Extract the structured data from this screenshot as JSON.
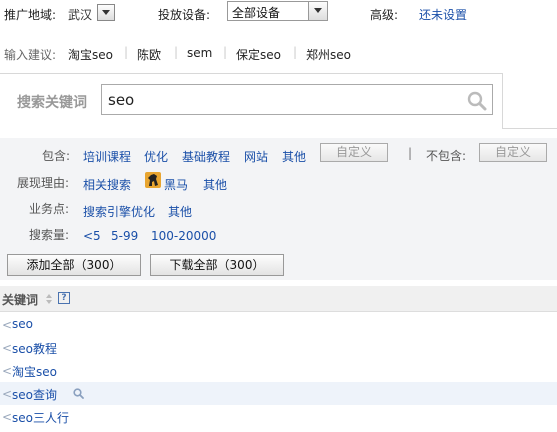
{
  "filters": {
    "region_label": "推广地域:",
    "region_value": "武汉",
    "device_label": "投放设备:",
    "device_value": "全部设备",
    "level_label": "高级:",
    "level_link": "还未设置"
  },
  "suggestions": {
    "label": "输入建议:",
    "items": [
      "淘宝seo",
      "陈欧",
      "sem",
      "保定seo",
      "郑州seo"
    ]
  },
  "search": {
    "label": "搜索关键词",
    "value": "seo"
  },
  "filter_rows": {
    "include_label": "包含:",
    "include_links": [
      "培训课程",
      "优化",
      "基础教程",
      "网站",
      "其他"
    ],
    "include_custom": "自定义",
    "exclude_label": "不包含:",
    "exclude_custom": "自定义",
    "reason_label": "展现理由:",
    "reason_links": [
      "相关搜索",
      "黑马",
      "其他"
    ],
    "business_label": "业务点:",
    "business_links": [
      "搜索引擎优化",
      "其他"
    ],
    "volume_label": "搜索量:",
    "volume_links": [
      "<5",
      "5-99",
      "100-20000"
    ]
  },
  "actions": {
    "add_all": "添加全部（300）",
    "download_all": "下载全部（300）"
  },
  "keywords": {
    "header": "关键词",
    "help": "?",
    "rows": [
      "seo",
      "seo教程",
      "淘宝seo",
      "seo查询",
      "seo三人行"
    ]
  },
  "colors": {
    "link": "#1a4fa8",
    "filter_bg": "#f3f4f6",
    "highlight_row": "#eef3fa"
  }
}
